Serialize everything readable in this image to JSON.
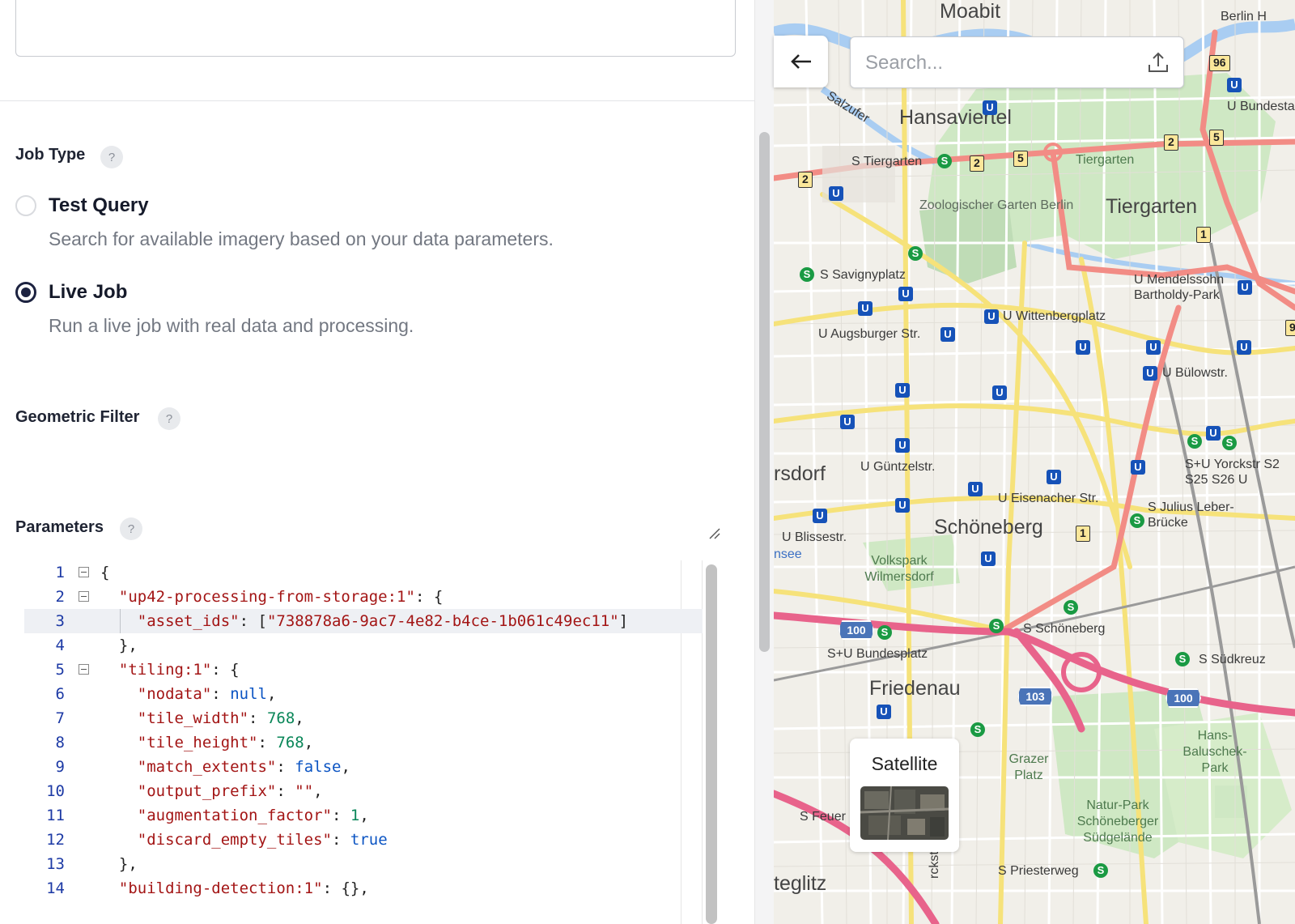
{
  "form": {
    "job_type": {
      "title": "Job Type",
      "help": "?",
      "options": [
        {
          "label": "Test Query",
          "description": "Search for available imagery based on your data parameters.",
          "selected": false
        },
        {
          "label": "Live Job",
          "description": "Run a live job with real data and processing.",
          "selected": true
        }
      ]
    },
    "geometric_filter": {
      "title": "Geometric Filter",
      "help": "?"
    },
    "parameters": {
      "title": "Parameters",
      "help": "?"
    }
  },
  "editor": {
    "lines": [
      {
        "n": "1",
        "text": "{"
      },
      {
        "n": "2",
        "text": "  \"up42-processing-from-storage:1\": {"
      },
      {
        "n": "3",
        "text": "    \"asset_ids\": [\"738878a6-9ac7-4e82-b4ce-1b061c49ec11\"]"
      },
      {
        "n": "4",
        "text": "  },"
      },
      {
        "n": "5",
        "text": "  \"tiling:1\": {"
      },
      {
        "n": "6",
        "text": "    \"nodata\": null,"
      },
      {
        "n": "7",
        "text": "    \"tile_width\": 768,"
      },
      {
        "n": "8",
        "text": "    \"tile_height\": 768,"
      },
      {
        "n": "9",
        "text": "    \"match_extents\": false,"
      },
      {
        "n": "10",
        "text": "    \"output_prefix\": \"\","
      },
      {
        "n": "11",
        "text": "    \"augmentation_factor\": 1,"
      },
      {
        "n": "12",
        "text": "    \"discard_empty_tiles\": true"
      },
      {
        "n": "13",
        "text": "  },"
      },
      {
        "n": "14",
        "text": "  \"building-detection:1\": {},"
      }
    ],
    "active_line": 3,
    "fold_lines": [
      1,
      2,
      5
    ]
  },
  "map": {
    "search_placeholder": "Search...",
    "satellite_label": "Satellite",
    "places": [
      "Moabit",
      "Hansaviertel",
      "Tiergarten",
      "rsdorf",
      "Schöneberg",
      "Friedenau",
      "teglitz"
    ],
    "small_labels": [
      "Berlin H",
      "U Bundesta",
      "Salzufer",
      "S Tiergarten",
      "Tiergarten",
      "Zoologischer Garten Berlin",
      "S Savignyplatz",
      "U Wittenbergplatz",
      "U Augsburger Str.",
      "U Mendelssohn Bartholdy-Park",
      "U Bülowstr.",
      "U Güntzelstr.",
      "U Eisenacher Str.",
      "S+U Yorckstr S2 S25 S26 U",
      "S Julius Leber-Brücke",
      "U Blissestr.",
      "nsee",
      "Volkspark Wilmersdorf",
      "S Schöneberg",
      "S+U Bundesplatz",
      "S Südkreuz",
      "Hans-Baluschek-Park",
      "Grazer Platz",
      "Natur-Park Schöneberger Südgelände",
      "S Feuer",
      "S Priesterweg",
      "rckstraße"
    ],
    "road_numbers": [
      "96",
      "2",
      "5",
      "2",
      "5",
      "2",
      "1",
      "1",
      "9"
    ],
    "highway_numbers": [
      "100",
      "103",
      "100"
    ],
    "colors": {
      "primary_road": "#f28c85",
      "secondary_road": "#f6e27a",
      "park": "#cfe8c4",
      "water": "#a9cdf2",
      "background": "#f1efe9"
    }
  }
}
